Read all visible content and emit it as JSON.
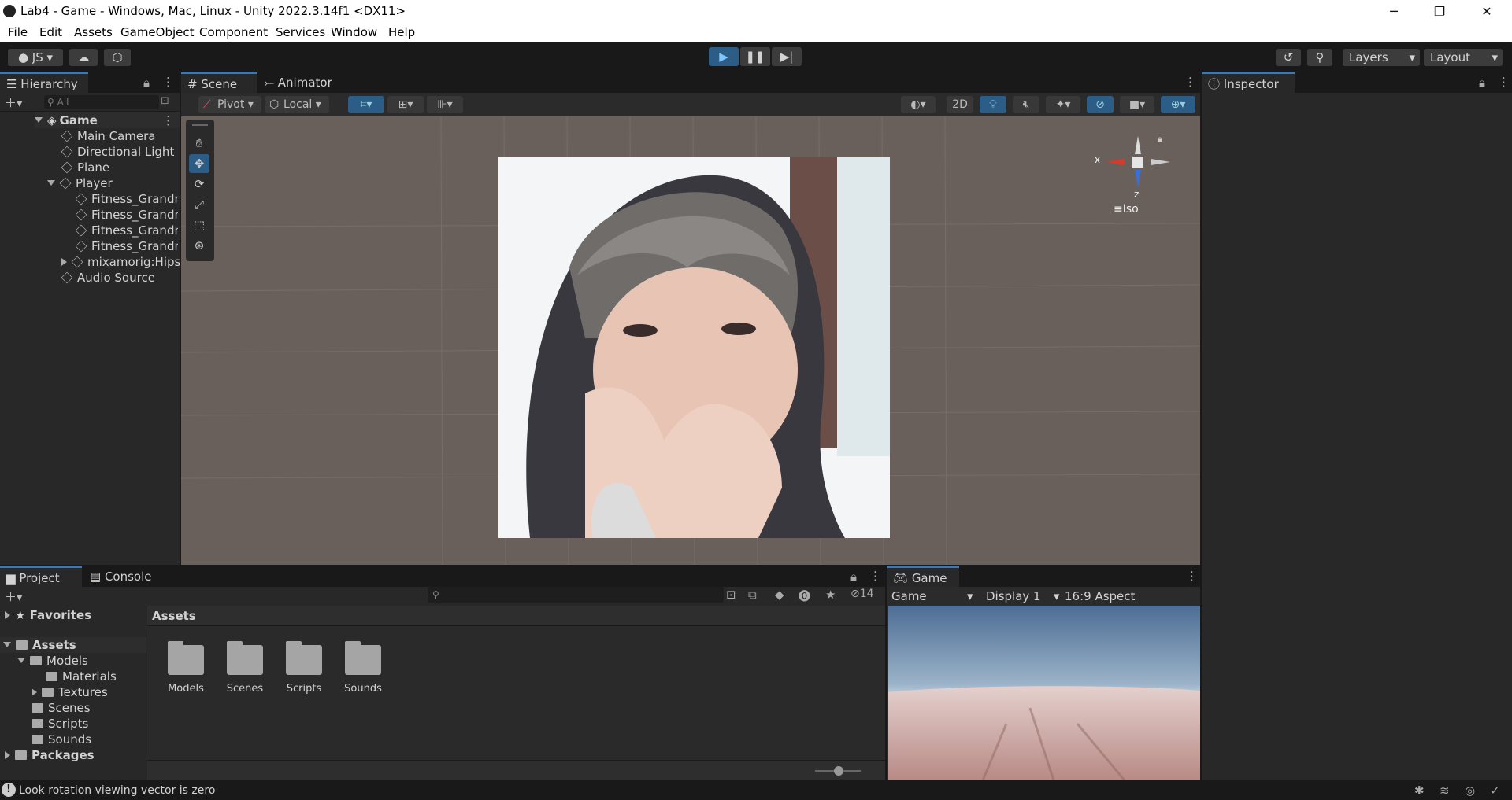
{
  "window": {
    "title": "Lab4 - Game - Windows, Mac, Linux - Unity 2022.3.14f1 <DX11>",
    "minimize": "─",
    "maximize": "❐",
    "close": "✕"
  },
  "menu": [
    "File",
    "Edit",
    "Assets",
    "GameObject",
    "Component",
    "Services",
    "Window",
    "Help"
  ],
  "toolbar": {
    "account": "JS",
    "layers": "Layers",
    "layout": "Layout"
  },
  "hierarchy": {
    "tab": "Hierarchy",
    "search_placeholder": "All",
    "scene": "Game",
    "items": [
      "Main Camera",
      "Directional Light",
      "Plane",
      "Player",
      "Fitness_Grandm",
      "Fitness_Grandm",
      "Fitness_Grandm",
      "Fitness_Grandm",
      "mixamorig:Hips",
      "Audio Source"
    ]
  },
  "scene": {
    "tabs": [
      "Scene",
      "Animator"
    ],
    "pivot": "Pivot",
    "local": "Local",
    "mode_2d": "2D",
    "gizmo_x": "x",
    "gizmo_z": "z",
    "projection": "Iso"
  },
  "inspector": {
    "tab": "Inspector"
  },
  "project": {
    "tabs": [
      "Project",
      "Console"
    ],
    "hidden_count": "14",
    "tree": {
      "favorites": "Favorites",
      "assets": "Assets",
      "models": "Models",
      "materials": "Materials",
      "textures": "Textures",
      "scenes": "Scenes",
      "scripts": "Scripts",
      "sounds": "Sounds",
      "packages": "Packages"
    },
    "breadcrumb": "Assets",
    "folders": [
      "Models",
      "Scenes",
      "Scripts",
      "Sounds"
    ]
  },
  "game": {
    "tab": "Game",
    "view": "Game",
    "display": "Display 1",
    "aspect": "16:9 Aspect"
  },
  "status": {
    "message": "Look rotation viewing vector is zero"
  },
  "colors": {
    "accent": "#3a79bb",
    "scene_bg": "#6a605b",
    "panel": "#282828"
  }
}
